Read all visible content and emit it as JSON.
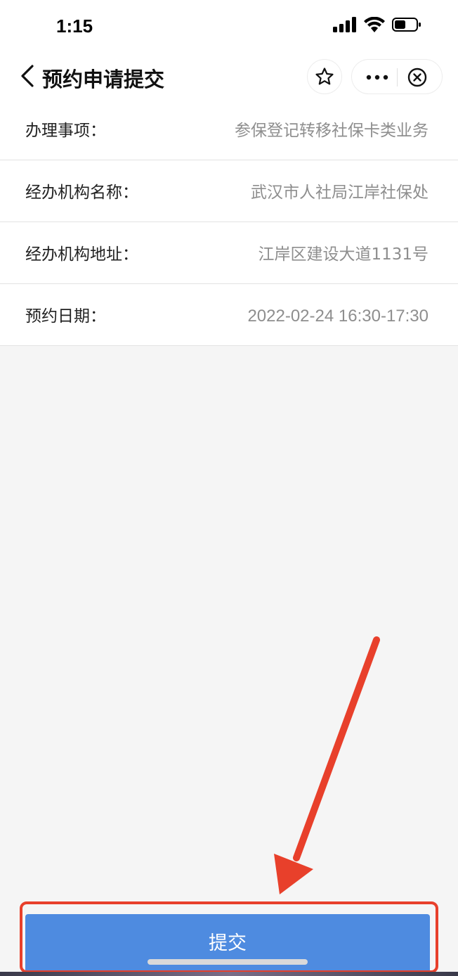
{
  "status_bar": {
    "time": "1:15"
  },
  "nav": {
    "title": "预约申请提交"
  },
  "form": {
    "rows": [
      {
        "label": "办理事项：",
        "value": "参保登记转移社保卡类业务"
      },
      {
        "label": "经办机构名称：",
        "value": "武汉市人社局江岸社保处"
      },
      {
        "label": "经办机构地址：",
        "value": "江岸区建设大道1131号"
      },
      {
        "label": "预约日期：",
        "value": "2022-02-24 16:30-17:30"
      }
    ]
  },
  "submit": {
    "label": "提交"
  },
  "annotation": {
    "color": "#e8402b"
  },
  "colors": {
    "accent": "#4e8be0",
    "background": "#f5f5f5"
  },
  "icons": [
    "signal-icon",
    "wifi-icon",
    "battery-icon",
    "back-icon",
    "star-icon",
    "more-icon",
    "close-icon",
    "arrow-annotation"
  ]
}
